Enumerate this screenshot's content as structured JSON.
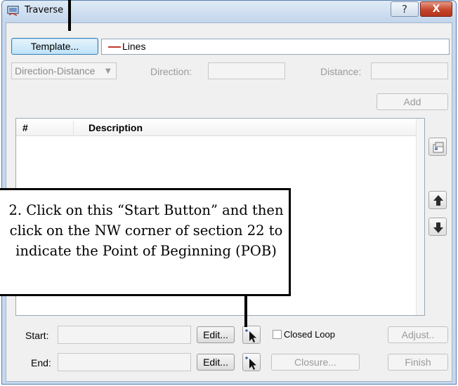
{
  "window": {
    "title": "Traverse",
    "help_glyph": "?",
    "close_glyph": "X",
    "accent": "#3c7fb1",
    "close_color": "#c6452b"
  },
  "template": {
    "button_label": "Template...",
    "value": "Lines",
    "line_color": "#c0392b"
  },
  "entry": {
    "mode_value": "Direction-Distance",
    "direction_label": "Direction:",
    "distance_label": "Distance:",
    "add_label": "Add"
  },
  "list": {
    "columns": [
      "#",
      "Description"
    ],
    "rows": []
  },
  "side_icons": [
    "properties-icon",
    "arrow-up-icon",
    "arrow-down-icon"
  ],
  "bottom": {
    "start_label": "Start:",
    "end_label": "End:",
    "edit_label": "Edit...",
    "closed_loop_label": "Closed Loop",
    "closed_loop_checked": false,
    "closure_label": "Closure...",
    "adjust_label": "Adjust..",
    "finish_label": "Finish"
  },
  "callout": {
    "text": "2. Click on this “Start Button” and then click on the NW corner of section 22 to indicate the Point of Beginning (POB)"
  }
}
